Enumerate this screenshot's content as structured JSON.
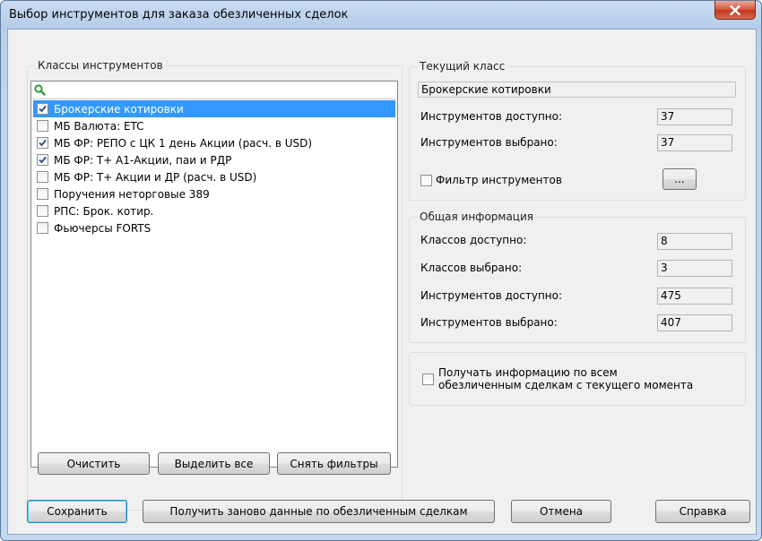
{
  "window": {
    "title": "Выбор инструментов для заказа обезличенных сделок"
  },
  "classes_group": {
    "legend": "Классы инструментов",
    "search_placeholder": "",
    "items": [
      {
        "label": "Брокерские котировки",
        "checked": true,
        "selected": true
      },
      {
        "label": "МБ Валюта: ETC",
        "checked": false,
        "selected": false
      },
      {
        "label": "МБ ФР: РЕПО с ЦК 1 день Акции (расч. в USD)",
        "checked": true,
        "selected": false
      },
      {
        "label": "МБ ФР: Т+ А1-Акции, паи и РДР",
        "checked": true,
        "selected": false
      },
      {
        "label": "МБ ФР: Т+ Акции и ДР (расч. в USD)",
        "checked": false,
        "selected": false
      },
      {
        "label": "Поручения неторговые 389",
        "checked": false,
        "selected": false
      },
      {
        "label": "РПС: Брок. котир.",
        "checked": false,
        "selected": false
      },
      {
        "label": "Фьючерсы FORTS",
        "checked": false,
        "selected": false
      }
    ],
    "buttons": {
      "clear": "Очистить",
      "select_all": "Выделить все",
      "remove_filters": "Снять фильтры"
    }
  },
  "current_class": {
    "legend": "Текущий класс",
    "name": "Брокерские котировки",
    "available_label": "Инструментов доступно:",
    "available_value": "37",
    "selected_label": "Инструментов выбрано:",
    "selected_value": "37",
    "filter_label": "Фильтр инструментов",
    "filter_button": "..."
  },
  "general_info": {
    "legend": "Общая информация",
    "classes_available_label": "Классов доступно:",
    "classes_available_value": "8",
    "classes_selected_label": "Классов выбрано:",
    "classes_selected_value": "3",
    "instr_available_label": "Инструментов доступно:",
    "instr_available_value": "475",
    "instr_selected_label": "Инструментов выбрано:",
    "instr_selected_value": "407"
  },
  "receive_all": {
    "line1": "Получать информацию по всем",
    "line2": "обезличенным сделкам с текущего момента"
  },
  "footer": {
    "save": "Сохранить",
    "refetch": "Получить заново данные по обезличенным сделкам",
    "cancel": "Отмена",
    "help": "Справка"
  }
}
